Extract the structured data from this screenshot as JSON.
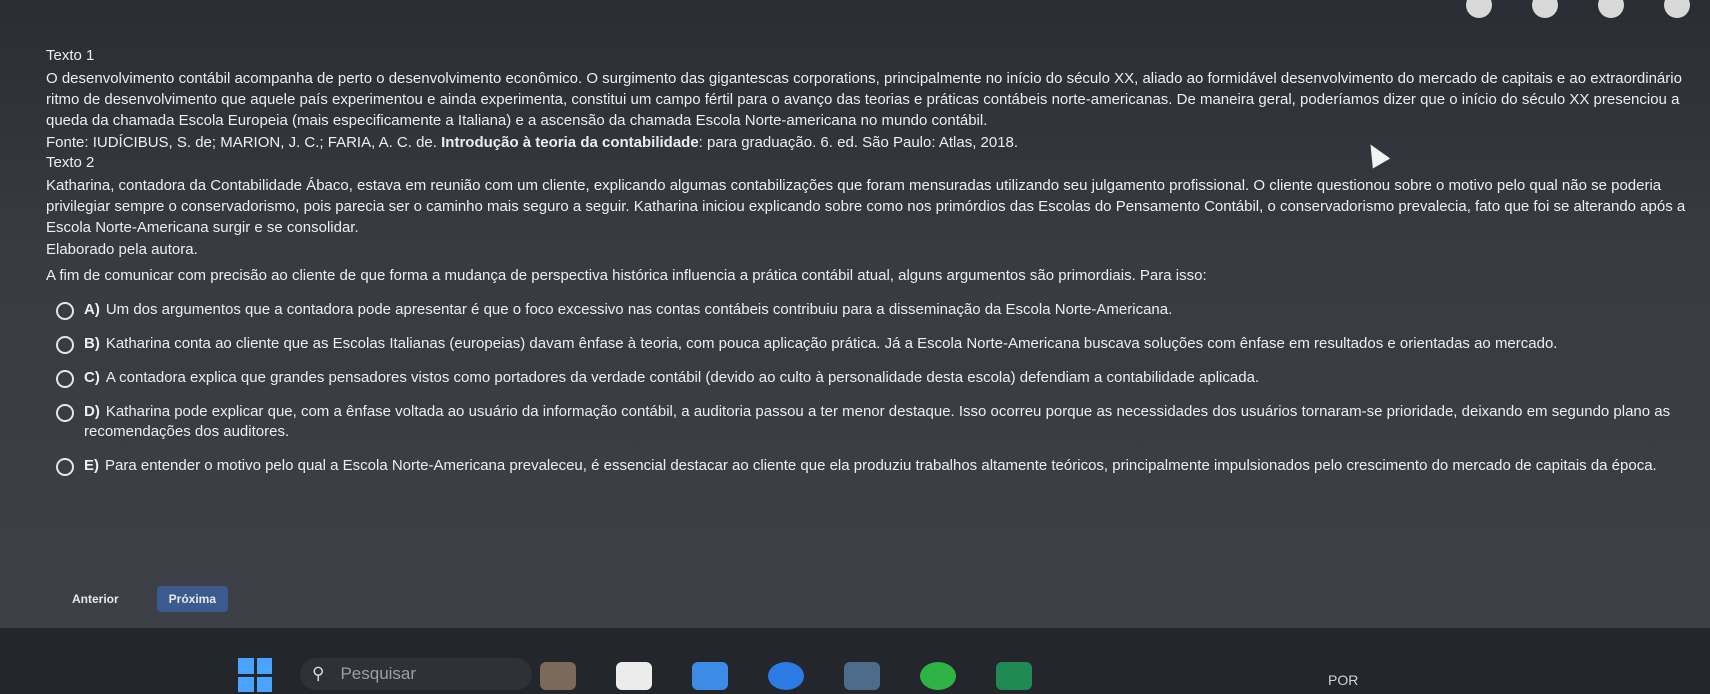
{
  "texto1": {
    "label": "Texto 1",
    "body": "O desenvolvimento contábil acompanha de perto o desenvolvimento econômico. O surgimento das gigantescas corporations, principalmente no início do século XX, aliado ao formidável desenvolvimento do mercado de capitais e ao extraordinário ritmo de desenvolvimento que aquele país experimentou e ainda experimenta, constitui um campo fértil para o avanço das teorias e práticas contábeis norte-americanas. De maneira geral, poderíamos dizer que o início do século XX presenciou a queda da chamada Escola Europeia (mais especificamente a Italiana) e a ascensão da chamada Escola Norte-americana no mundo contábil.",
    "source_prefix": "Fonte: IUDÍCIBUS, S. de; MARION, J. C.; FARIA, A. C. de.",
    "source_title": "Introdução à teoria da contabilidade",
    "source_suffix": ": para graduação. 6. ed. São Paulo: Atlas, 2018."
  },
  "texto2": {
    "label": "Texto 2",
    "body": "Katharina, contadora da Contabilidade Ábaco, estava em reunião com um cliente, explicando algumas contabilizações que foram mensuradas utilizando seu julgamento profissional. O cliente questionou sobre o motivo pelo qual não se poderia privilegiar sempre o conservadorismo, pois parecia ser o caminho mais seguro a seguir. Katharina iniciou explicando sobre como nos primórdios das Escolas do Pensamento Contábil, o conservadorismo prevalecia, fato que foi se alterando após a Escola Norte-Americana surgir e se consolidar.",
    "source": "Elaborado pela autora."
  },
  "question": "A fim de comunicar com precisão ao cliente de que forma a mudança de perspectiva histórica influencia a prática contábil atual, alguns argumentos são primordiais. Para isso:",
  "options": [
    {
      "letter": "A)",
      "text": "Um dos argumentos que a contadora pode apresentar é que o foco excessivo nas contas contábeis contribuiu para a disseminação da Escola Norte-Americana."
    },
    {
      "letter": "B)",
      "text": "Katharina conta ao cliente que as Escolas Italianas (europeias) davam ênfase à teoria, com pouca aplicação prática. Já a Escola Norte-Americana buscava soluções com ênfase em resultados e orientadas ao mercado."
    },
    {
      "letter": "C)",
      "text": "A contadora explica que grandes pensadores vistos como portadores da verdade contábil (devido ao culto à personalidade desta escola) defendiam a contabilidade aplicada."
    },
    {
      "letter": "D)",
      "text": "Katharina pode explicar que, com a ênfase voltada ao usuário da informação contábil, a auditoria passou a ter menor destaque. Isso ocorreu porque as necessidades dos usuários tornaram-se prioridade, deixando em segundo plano as recomendações dos auditores."
    },
    {
      "letter": "E)",
      "text": "Para entender o motivo pelo qual a Escola Norte-Americana prevaleceu, é essencial destacar ao cliente que ela produziu trabalhos altamente teóricos, principalmente impulsionados pelo crescimento do mercado de capitais da época."
    }
  ],
  "nav": {
    "prev": "Anterior",
    "next": "Próxima"
  },
  "taskbar": {
    "search_placeholder": "Pesquisar",
    "lang": "POR"
  },
  "colors": {
    "next_button": "#3b5b8f",
    "windows_blue": "#4aa3ff"
  }
}
